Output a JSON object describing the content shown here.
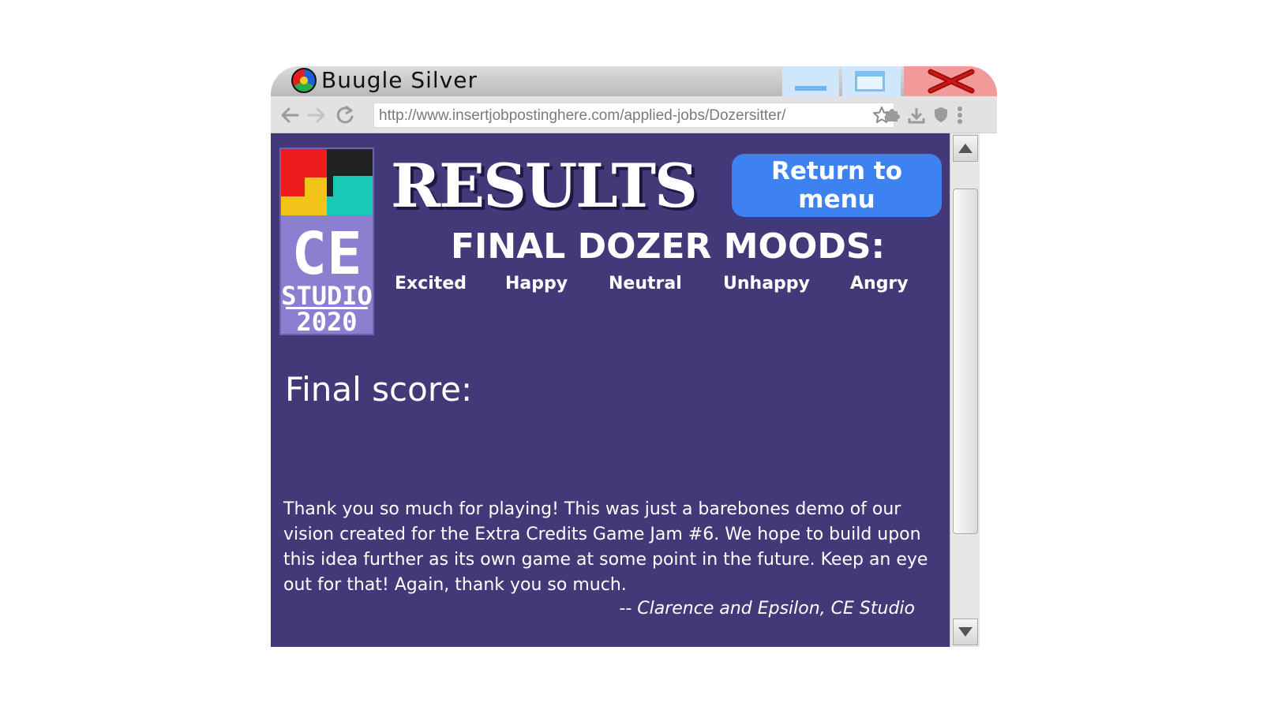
{
  "browser": {
    "title": "Buugle Silver",
    "url": "http://www.insertjobpostinghere.com/applied-jobs/Dozersitter/",
    "icons": [
      "back-icon",
      "forward-icon",
      "reload-icon",
      "bookmark-star-icon",
      "puzzle-icon",
      "download-icon",
      "shield-icon",
      "more-icon"
    ]
  },
  "game": {
    "results_title": "RESULTS",
    "menu_button": "Return to menu",
    "moods_title": "FINAL DOZER MOODS:",
    "moods": [
      "Excited",
      "Happy",
      "Neutral",
      "Unhappy",
      "Angry"
    ],
    "final_score_label": "Final score:",
    "thanks_text": "Thank you so much for playing! This was just a barebones demo of our vision created for the Extra Credits Game Jam #6. We hope to build upon this idea further as its own game at some point in the future. Keep an eye out for that! Again, thank you so much.",
    "signature": "-- Clarence and Epsilon, CE Studio",
    "studio_logo": {
      "line1": "CE",
      "line2": "STUDIO",
      "line3": "2020"
    }
  },
  "colors": {
    "content_bg": "#433979",
    "menu_button": "#3d82f0",
    "logo_bg": "#8a80cf"
  }
}
